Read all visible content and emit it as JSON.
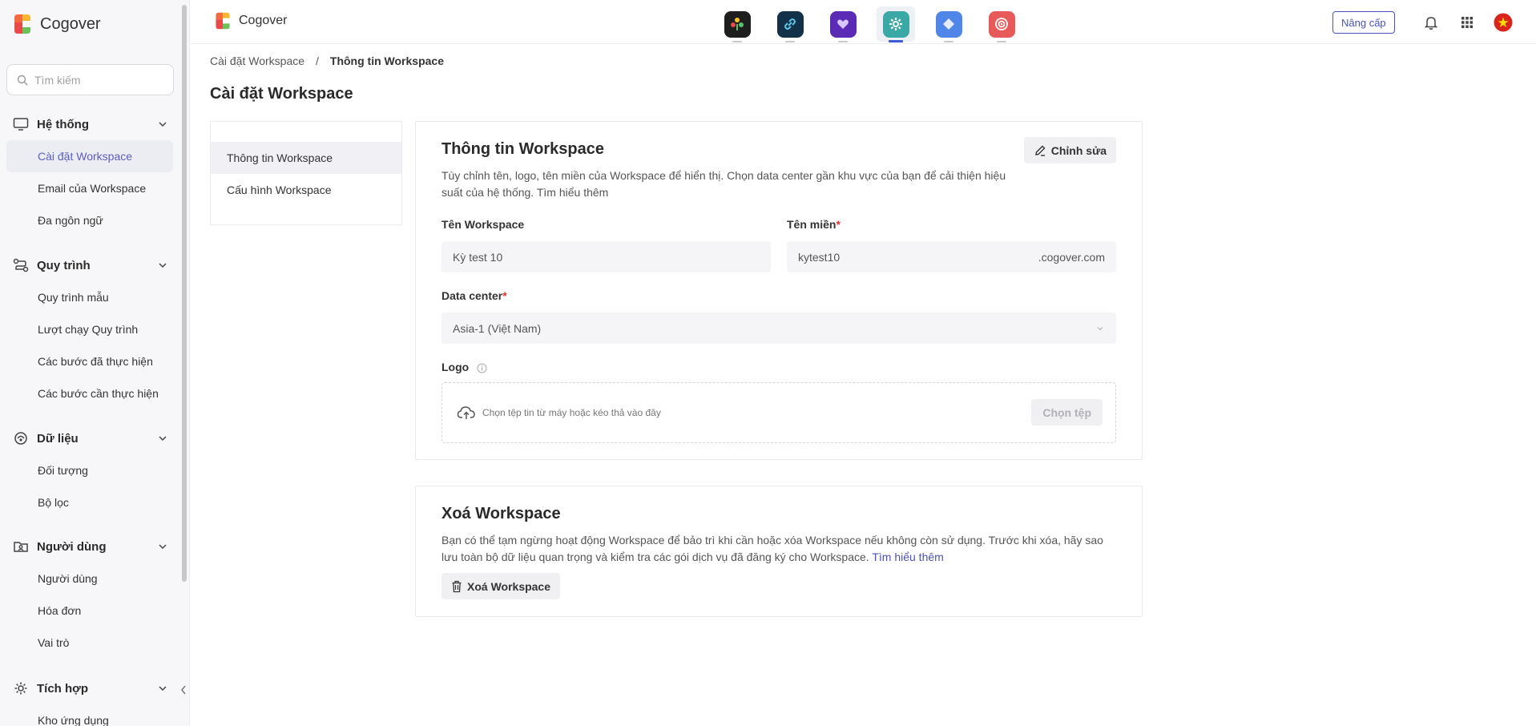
{
  "brand": {
    "name": "Cogover"
  },
  "sidebar": {
    "search_placeholder": "Tìm kiếm",
    "groups": [
      {
        "label": "Hệ thống",
        "icon": "monitor-icon",
        "items": [
          "Cài đặt Workspace",
          "Email của Workspace",
          "Đa ngôn ngữ"
        ]
      },
      {
        "label": "Quy trình",
        "icon": "workflow-icon",
        "items": [
          "Quy trình mẫu",
          "Lượt chạy Quy trình",
          "Các bước đã thực hiện",
          "Các bước cần thực hiện"
        ]
      },
      {
        "label": "Dữ liệu",
        "icon": "data-icon",
        "items": [
          "Đối tượng",
          "Bộ lọc"
        ]
      },
      {
        "label": "Người dùng",
        "icon": "users-folder-icon",
        "items": [
          "Người dùng",
          "Hóa đơn",
          "Vai trò"
        ]
      },
      {
        "label": "Tích hợp",
        "icon": "integration-icon",
        "items": [
          "Kho ứng dụng"
        ]
      }
    ],
    "active_item": "Cài đặt Workspace"
  },
  "topbar": {
    "brand": "Cogover",
    "apps": [
      {
        "name": "app-1",
        "color": "#1e1e1e"
      },
      {
        "name": "app-2",
        "color": "#13324a"
      },
      {
        "name": "app-3",
        "color": "#5b2bb5"
      },
      {
        "name": "settings-app",
        "color": "#3aa9a6",
        "active": true
      },
      {
        "name": "app-5",
        "color": "#4f86e8"
      },
      {
        "name": "app-6",
        "color": "#e85a5a"
      }
    ],
    "upgrade_label": "Nâng cấp"
  },
  "breadcrumb": {
    "parent": "Cài đặt Workspace",
    "separator": "/",
    "current": "Thông tin Workspace"
  },
  "page_title": "Cài đặt Workspace",
  "subnav": [
    "Thông tin Workspace",
    "Cấu hình Workspace"
  ],
  "info_card": {
    "title": "Thông tin Workspace",
    "edit_label": "Chỉnh sửa",
    "desc_line1": "Tùy chỉnh tên, logo, tên miền của Workspace để hiển thị. Chọn data center gần khu vực của bạn để cải thiện hiệu",
    "desc_line2": "suất của hệ thống. Tìm hiểu thêm",
    "name_label": "Tên Workspace",
    "name_value": "Kỳ test 10",
    "domain_label": "Tên miền",
    "domain_value": "kytest10",
    "domain_suffix": ".cogover.com",
    "dc_label": "Data center",
    "dc_value": "Asia-1 (Việt Nam)",
    "logo_label": "Logo",
    "drop_text": "Chọn tệp tin từ máy hoặc kéo thả vào đây",
    "choose_label": "Chọn tệp"
  },
  "delete_card": {
    "title": "Xoá Workspace",
    "desc_line1": "Bạn có thể tạm ngừng hoạt động Workspace để bảo trì khi cần hoặc xóa Workspace nếu không còn sử dụng. Trước khi xóa, hãy sao",
    "desc_line2": "lưu toàn bộ dữ liệu quan trọng và kiểm tra các gói dịch vụ đã đăng ký cho Workspace.",
    "link": "Tìm hiểu thêm",
    "button": "Xoá Workspace"
  }
}
